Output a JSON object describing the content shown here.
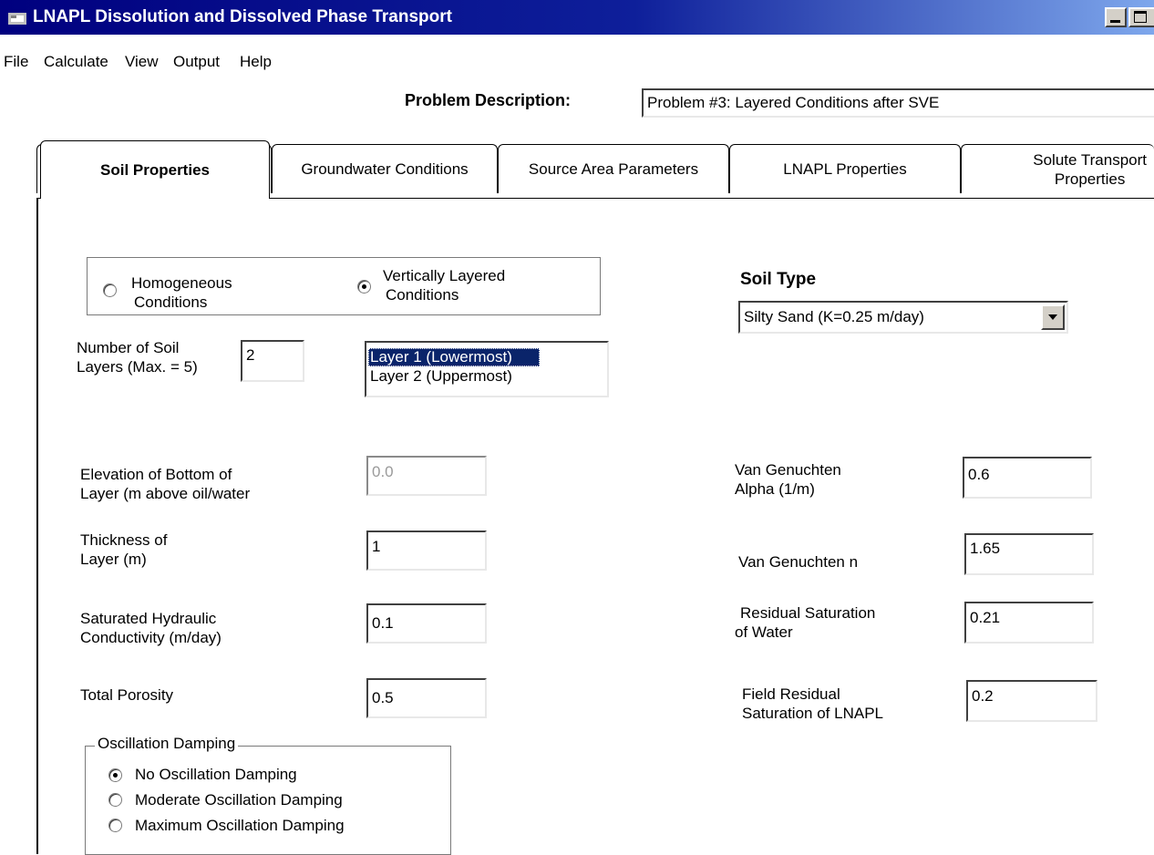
{
  "window": {
    "title": "LNAPL Dissolution and Dissolved Phase Transport",
    "icon": "app-window-icon",
    "accent": "#00007f"
  },
  "menu": {
    "file": "File",
    "calculate": "Calculate",
    "view": "View",
    "output": "Output",
    "help": "Help"
  },
  "problem": {
    "label": "Problem Description:",
    "value": "Problem #3: Layered Conditions after SVE"
  },
  "tabs": {
    "soil": "Soil Properties",
    "groundwater": "Groundwater Conditions",
    "source": "Source Area Parameters",
    "lnapl": "LNAPL Properties",
    "solute_line1": "Solute Transport",
    "solute_line2": "Properties"
  },
  "conditions": {
    "homogeneous_line1": "Homogeneous",
    "homogeneous_line2": "Conditions",
    "layered_line1": "Vertically Layered",
    "layered_line2": "Conditions",
    "selected": "layered"
  },
  "layers": {
    "label_line1": "Number of Soil",
    "label_line2": "Layers (Max. = 5)",
    "count": "2",
    "items": [
      "Layer 1 (Lowermost)",
      "Layer 2 (Uppermost)"
    ],
    "selected_index": 0
  },
  "soil_type": {
    "label": "Soil Type",
    "value": "Silty Sand (K=0.25 m/day)"
  },
  "left_fields": {
    "elevation": {
      "line1": "Elevation of Bottom of",
      "line2": "Layer (m above oil/water",
      "value": "0.0"
    },
    "thickness": {
      "line1": "Thickness of",
      "line2": "Layer (m)",
      "value": "1"
    },
    "conductivity": {
      "line1": "Saturated Hydraulic",
      "line2": "Conductivity (m/day)",
      "value": "0.1"
    },
    "porosity": {
      "line1": "Total Porosity",
      "value": "0.5"
    }
  },
  "right_fields": {
    "alpha": {
      "line1": "Van Genuchten",
      "line2": "Alpha (1/m)",
      "value": "0.6"
    },
    "n": {
      "line1": "Van Genuchten n",
      "value": "1.65"
    },
    "water_sat": {
      "line1": "Residual Saturation",
      "line2": "of Water",
      "value": "0.21"
    },
    "lnapl_sat": {
      "line1": "Field Residual",
      "line2": "Saturation of LNAPL",
      "value": "0.2"
    }
  },
  "damping": {
    "title": "Oscillation Damping",
    "options": [
      "No Oscillation Damping",
      "Moderate Oscillation Damping",
      "Maximum Oscillation Damping"
    ],
    "selected_index": 0
  }
}
